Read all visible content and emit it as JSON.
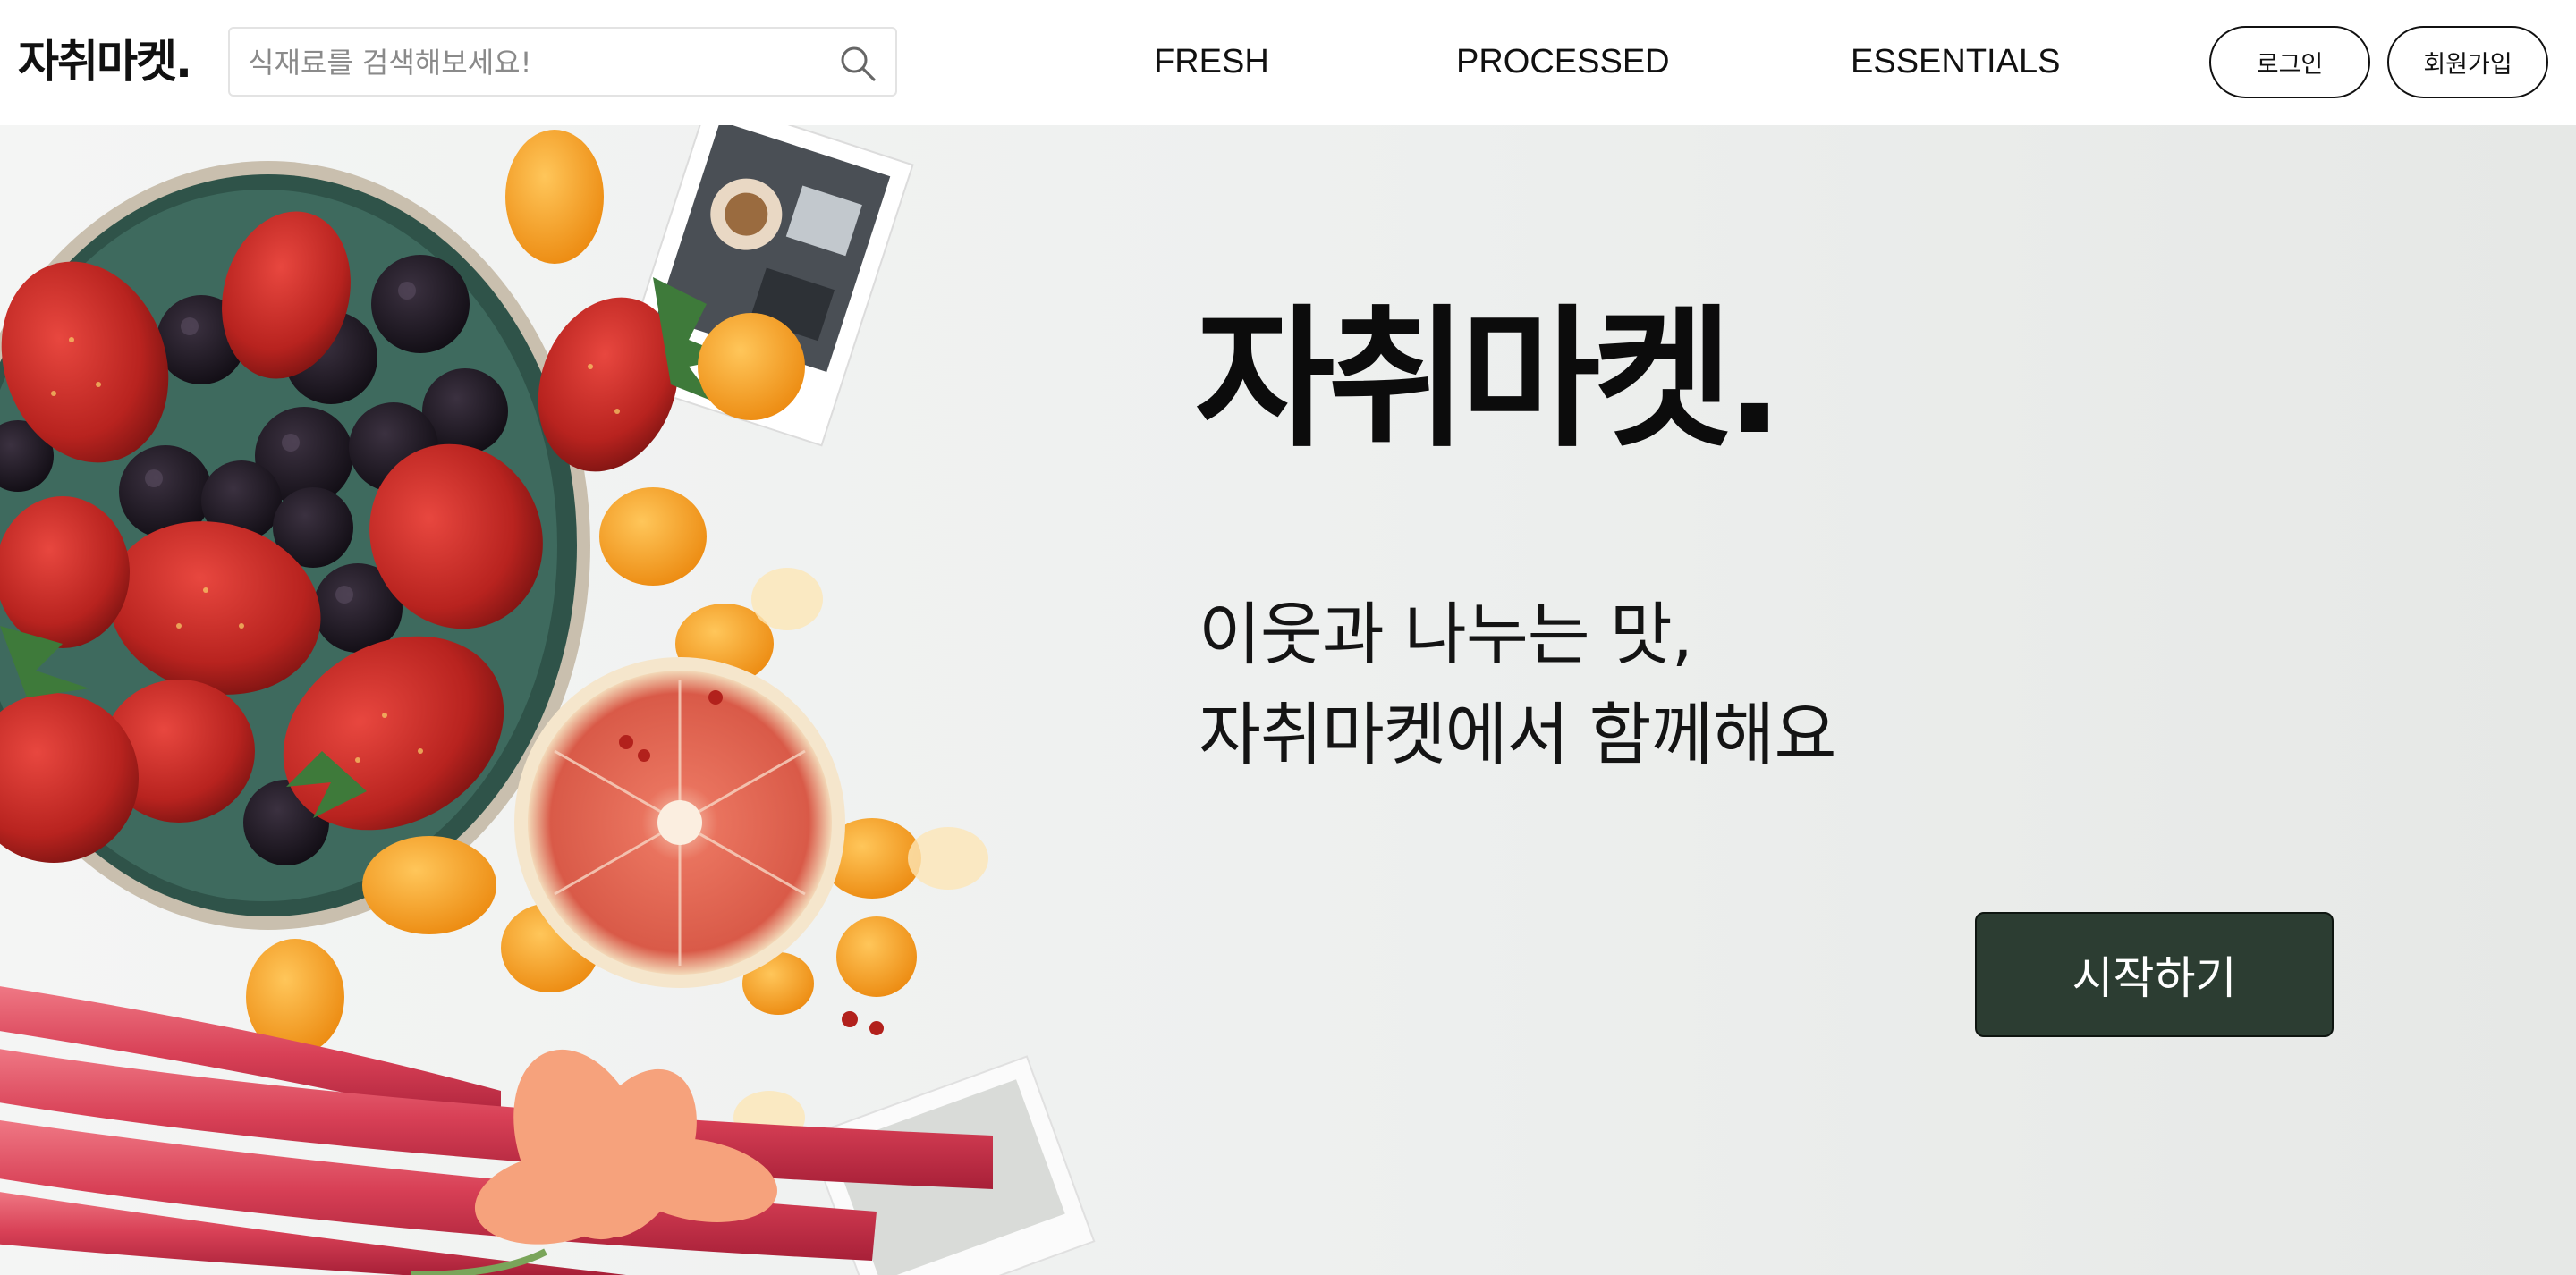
{
  "header": {
    "logo": "자취마켓.",
    "search": {
      "placeholder": "식재료를 검색해보세요!",
      "value": "",
      "icon": "search-icon"
    },
    "nav": [
      "FRESH",
      "PROCESSED",
      "ESSENTIALS"
    ],
    "login_label": "로그인",
    "signup_label": "회원가입"
  },
  "hero": {
    "title": "자취마켓.",
    "subtitle_line1": "이웃과 나누는 맛,",
    "subtitle_line2": "자취마켓에서 함께해요",
    "cta_label": "시작하기",
    "image": "fruit-bowl-photo"
  },
  "colors": {
    "cta_background": "#2c3d32",
    "header_background": "#ffffff",
    "hero_background": "#eef0ef",
    "text": "#111111"
  }
}
